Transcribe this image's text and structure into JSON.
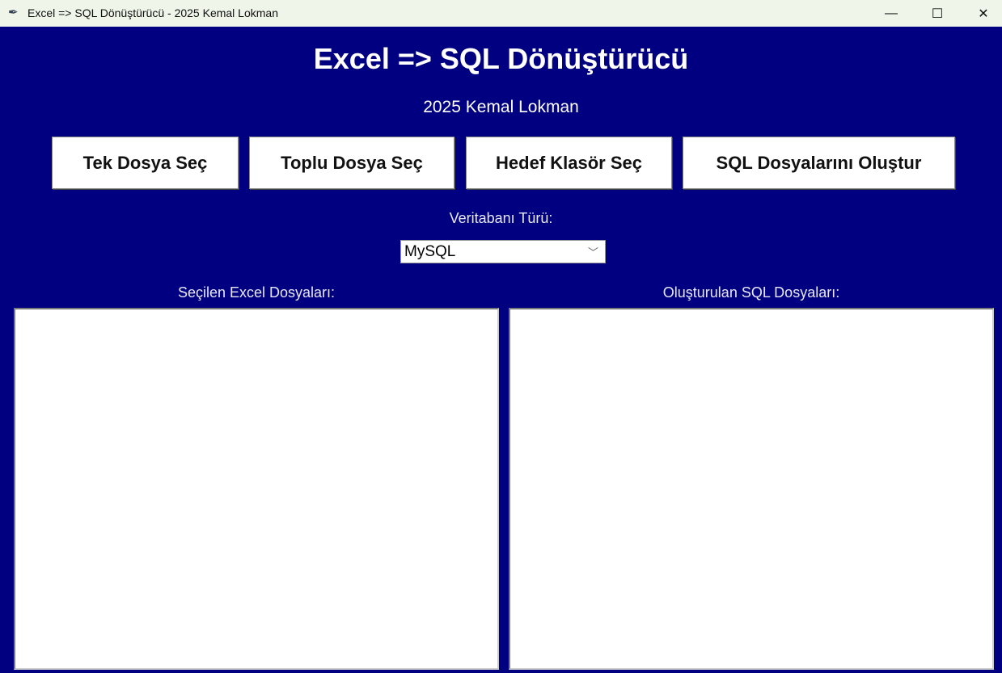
{
  "window": {
    "title": "Excel => SQL Dönüştürücü - 2025 Kemal Lokman",
    "icon": "feather-icon"
  },
  "header": {
    "title": "Excel => SQL Dönüştürücü",
    "subtitle": "2025 Kemal Lokman"
  },
  "buttons": {
    "single": "Tek Dosya Seç",
    "bulk": "Toplu Dosya Seç",
    "target": "Hedef Klasör Seç",
    "create": "SQL Dosyalarını Oluştur"
  },
  "db": {
    "label": "Veritabanı Türü:",
    "selected": "MySQL"
  },
  "lists": {
    "excel_label": "Seçilen Excel Dosyaları:",
    "sql_label": "Oluşturulan SQL Dosyaları:"
  },
  "colors": {
    "background": "#000080"
  }
}
